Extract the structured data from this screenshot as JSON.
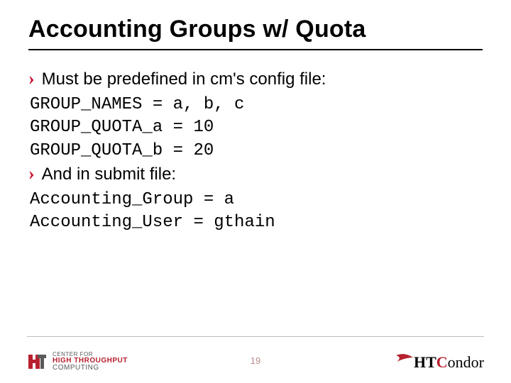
{
  "title": "Accounting Groups w/ Quota",
  "bullets": [
    "Must be predefined in cm's config file:",
    "And in submit file:"
  ],
  "code_blocks": [
    "GROUP_NAMES = a, b, c\nGROUP_QUOTA_a = 10\nGROUP_QUOTA_b = 20",
    "Accounting_Group = a\nAccounting_User = gthain"
  ],
  "page_number": "19",
  "logo_left": {
    "line1": "CENTER FOR",
    "line2": "HIGH THROUGHPUT",
    "line3": "COMPUTING"
  },
  "logo_right": {
    "part1": "HT",
    "part2": "C",
    "part3": "ondor"
  }
}
